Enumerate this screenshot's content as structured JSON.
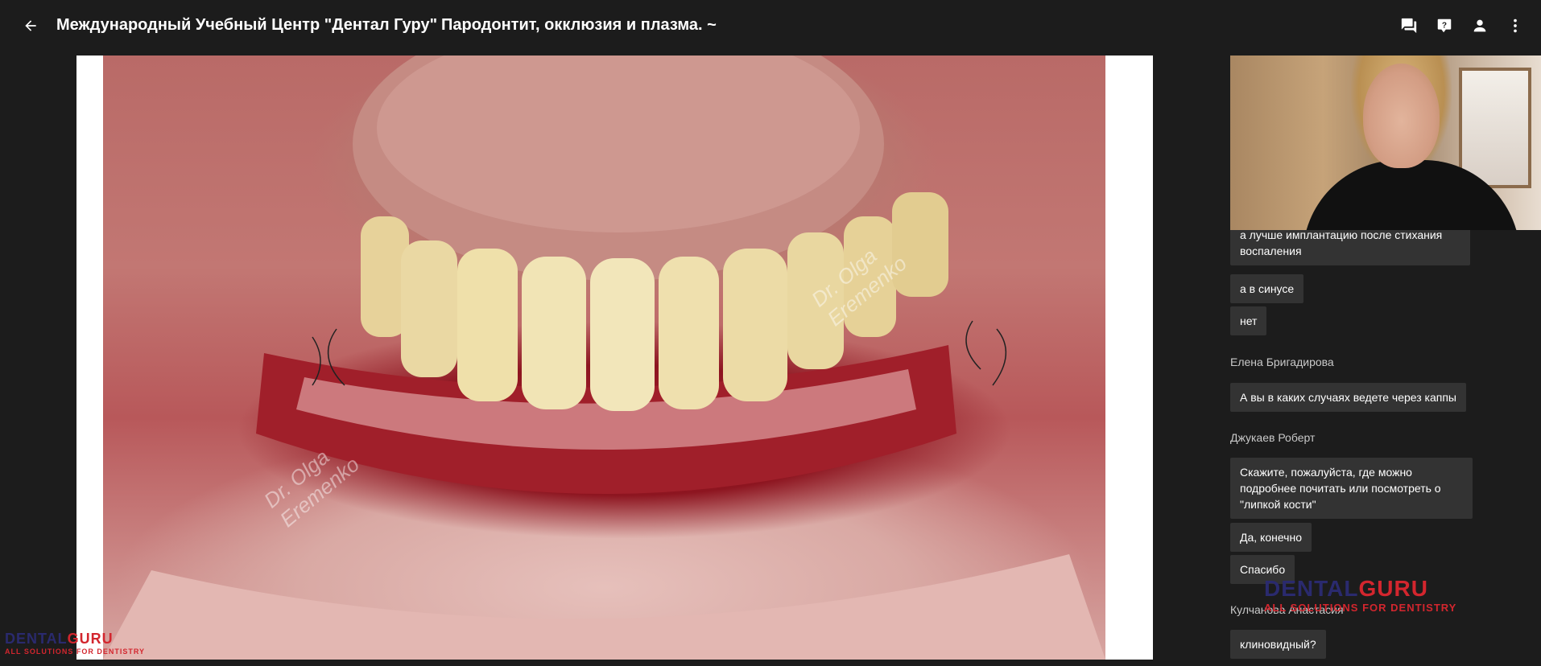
{
  "header": {
    "org_title": "Международный Учебный Центр \"Дентал Гуру\"",
    "event_title": "Пародонтит, окклюзия и плазма. ~"
  },
  "icons": {
    "back": "arrow-left-icon",
    "chat": "chat-icon",
    "qa": "question-icon",
    "profile": "person-icon",
    "more": "more-vert-icon"
  },
  "slide": {
    "watermark": "Dr. Olga Eremenko",
    "watermark_line1": "Dr. Olga",
    "watermark_line2": "Eremenko"
  },
  "chat": {
    "messages": [
      {
        "text": "а лучше имплантацию после стихания воспаления"
      },
      {
        "text": "а в синусе"
      },
      {
        "text": "нет"
      }
    ],
    "groups": [
      {
        "sender": "Елена Бригадирова",
        "messages": [
          "А вы в каких случаях ведете через каппы"
        ]
      },
      {
        "sender": "Джукаев Роберт",
        "messages": [
          "Скажите, пожалуйста, где можно подробнее почитать или посмотреть о \"липкой кости\"",
          "Да, конечно",
          "Спасибо"
        ]
      },
      {
        "sender": "Кулчанова Анастасия",
        "messages": [
          "клиновидный?"
        ]
      }
    ]
  },
  "brand": {
    "dental": "DENTAL",
    "guru": "GURU",
    "tagline": "ALL SOLUTIONS FOR DENTISTRY",
    "colors": {
      "navy": "#2a2a6e",
      "red": "#d3262e"
    }
  },
  "theme": {
    "background": "#1c1c1c",
    "bubble": "#333333",
    "sender_text": "#c9c9c9"
  }
}
